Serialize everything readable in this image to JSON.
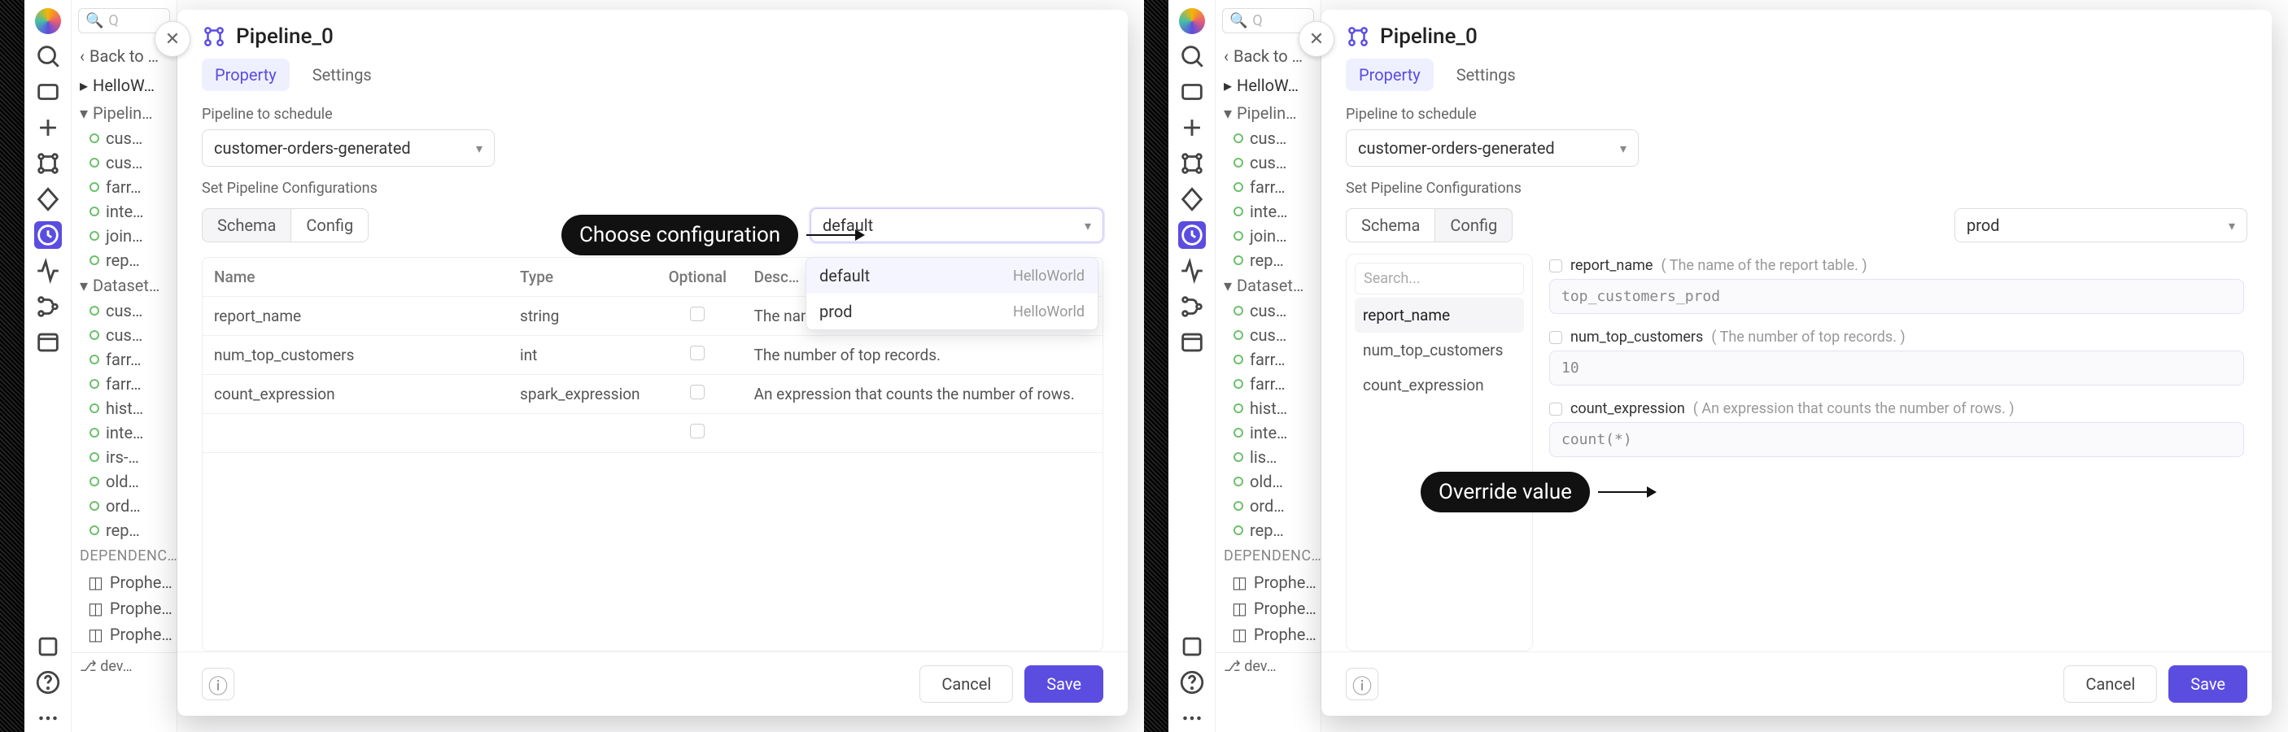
{
  "sidebar_icons": [
    "logo",
    "search",
    "box",
    "plus",
    "graph",
    "diamond",
    "clock",
    "activity",
    "branches",
    "window",
    "square",
    "help",
    "dots"
  ],
  "tree": {
    "back": "Back to …",
    "project": "HelloW…",
    "pipelines_label": "Pipelin…",
    "pipelines": [
      "cus…",
      "cus…",
      "farr…",
      "inte…",
      "join…",
      "rep…"
    ],
    "datasets_label": "Dataset…",
    "datasets": [
      "cus…",
      "cus…",
      "farr…",
      "farr…",
      "hist…",
      "inte…",
      "irs-…",
      "old…",
      "ord…",
      "rep…"
    ],
    "datasets_right": [
      "cus…",
      "cus…",
      "farr…",
      "farr…",
      "hist…",
      "inte…",
      "lis…",
      "old…",
      "ord…",
      "rep…"
    ],
    "deps_label": "DEPENDENC…",
    "deps": [
      "Prophe…",
      "Prophe…",
      "Prophe…"
    ],
    "status": "dev…"
  },
  "modal": {
    "title": "Pipeline_0",
    "tabs": [
      "Property",
      "Settings"
    ],
    "active_tab": 0,
    "pipeline_label": "Pipeline to schedule",
    "pipeline_value": "customer-orders-generated",
    "cfg_label": "Set Pipeline Configurations",
    "seg": [
      "Schema",
      "Config"
    ],
    "seg_on_left": 0,
    "seg_on_right": 1,
    "config_dd_left": "default",
    "config_dd_right": "prod",
    "config_options": [
      {
        "name": "default",
        "src": "HelloWorld"
      },
      {
        "name": "prod",
        "src": "HelloWorld"
      }
    ],
    "table": {
      "headers": [
        "Name",
        "Type",
        "Optional",
        "Desc…"
      ],
      "rows": [
        {
          "name": "report_name",
          "type": "string",
          "opt": false,
          "desc": "The name of the report table."
        },
        {
          "name": "num_top_customers",
          "type": "int",
          "opt": false,
          "desc": "The number of top records."
        },
        {
          "name": "count_expression",
          "type": "spark_expression",
          "opt": false,
          "desc": "An expression that counts the number of rows."
        }
      ]
    },
    "config_form": {
      "search_placeholder": "Search...",
      "items": [
        "report_name",
        "num_top_customers",
        "count_expression"
      ],
      "selected": 0,
      "fields": [
        {
          "name": "report_name",
          "desc": "( The name of the report table. )",
          "value": "top_customers_prod"
        },
        {
          "name": "num_top_customers",
          "desc": "( The number of top records. )",
          "value": "10"
        },
        {
          "name": "count_expression",
          "desc": "( An expression that counts the number of rows. )",
          "value": "count(*)"
        }
      ]
    },
    "buttons": {
      "cancel": "Cancel",
      "save": "Save"
    }
  },
  "annotations": {
    "left": "Choose configuration",
    "right": "Override value"
  }
}
